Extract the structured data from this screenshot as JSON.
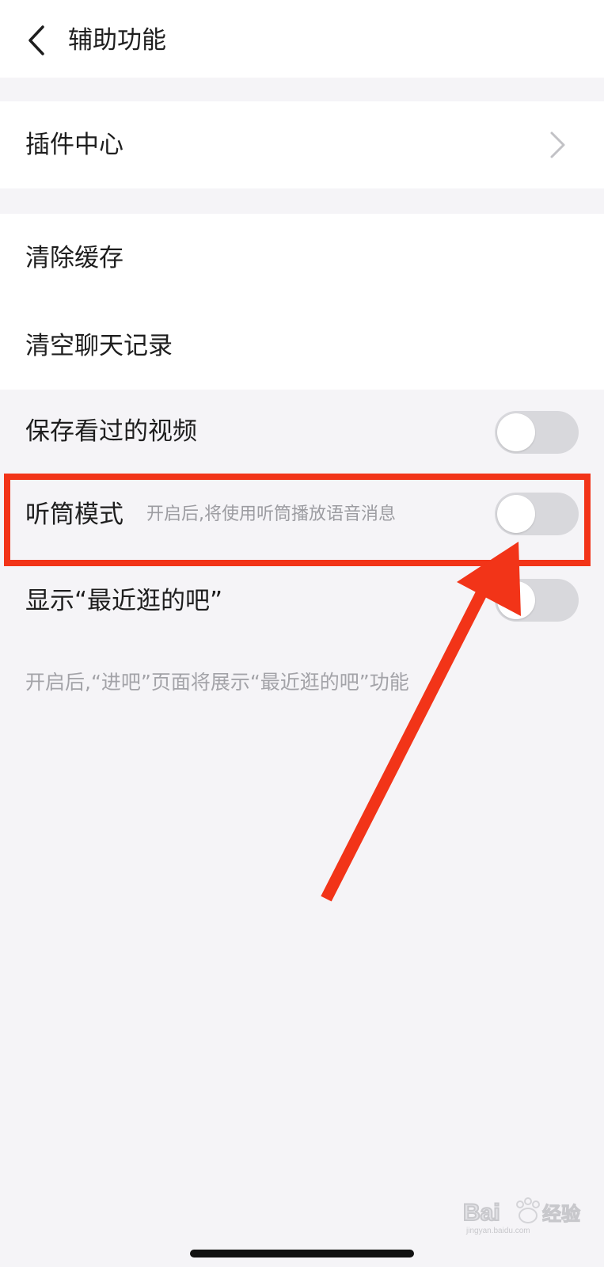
{
  "nav": {
    "title": "辅助功能",
    "back_icon": "chevron-left-icon"
  },
  "groups": {
    "plugin_center": {
      "label": "插件中心",
      "icon": "chevron-right-icon"
    },
    "clear_cache": {
      "label": "清除缓存"
    },
    "clear_chat_history": {
      "label": "清空聊天记录"
    }
  },
  "toggles": {
    "save_watched_videos": {
      "label": "保存看过的视频",
      "on": false
    },
    "earpiece_mode": {
      "label": "听筒模式",
      "description": "开启后,将使用听筒播放语音消息",
      "on": false
    },
    "show_recent_bars": {
      "label": "显示“最近逛的吧”",
      "on": false
    }
  },
  "footnote": "开启后,“进吧”页面将展示“最近逛的吧”功能",
  "annotation": {
    "color": "#f23418"
  },
  "watermark": {
    "text": "Bai du 经验",
    "subtext": "jingyan.baidu.com"
  },
  "colors": {
    "background": "#f5f4f7",
    "card": "#ffffff",
    "toggle_off": "#d8d8dc",
    "secondary_text": "#9c9ca1"
  }
}
